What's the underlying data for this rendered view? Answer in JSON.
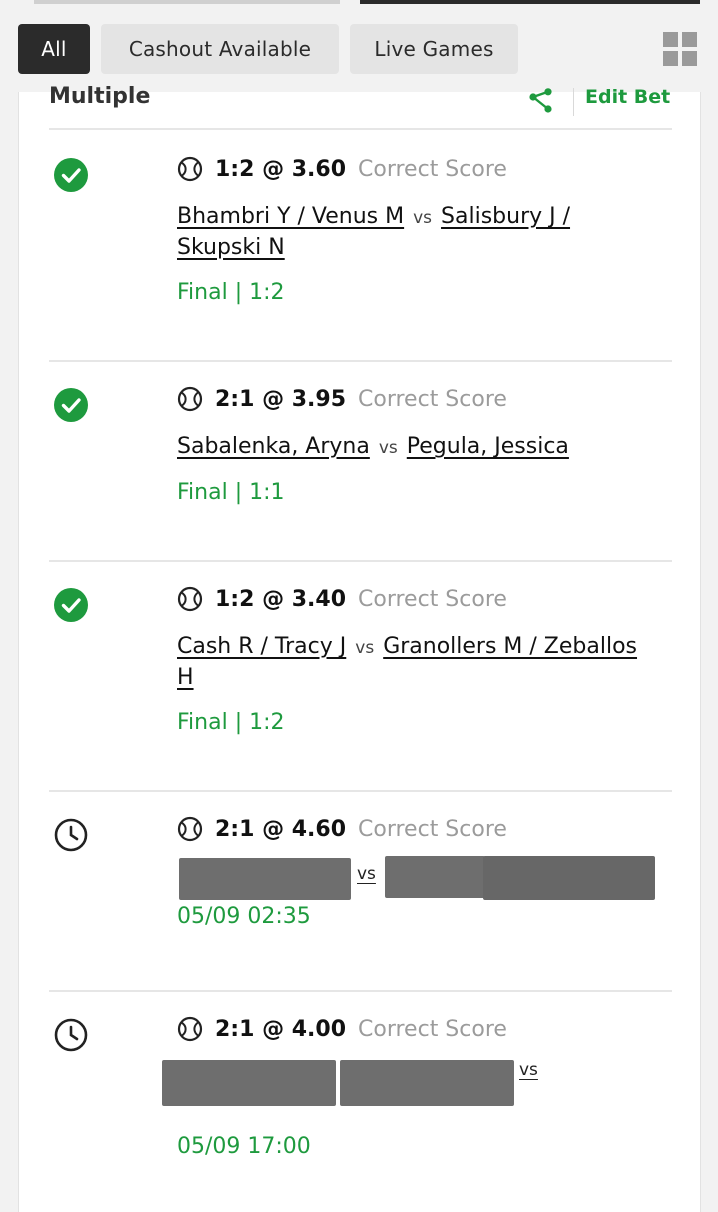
{
  "filters": {
    "all": "All",
    "cashout": "Cashout Available",
    "live": "Live Games",
    "layout_icon": "grid-view-icon"
  },
  "bet": {
    "type": "Multiple",
    "edit_label": "Edit Bet",
    "share_icon": "share-icon"
  },
  "legs": [
    {
      "status": "won",
      "status_icon": "check-circle-icon",
      "selection": "1:2 @ 3.60",
      "market": "Correct Score",
      "home": "Bhambri Y / Venus M",
      "vs": "vs",
      "away": "Salisbury J / Skupski N",
      "result": "Final | 1:2"
    },
    {
      "status": "won",
      "status_icon": "check-circle-icon",
      "selection": "2:1 @ 3.95",
      "market": "Correct Score",
      "home": "Sabalenka, Aryna",
      "vs": "vs",
      "away": "Pegula, Jessica",
      "result": "Final | 1:1"
    },
    {
      "status": "won",
      "status_icon": "check-circle-icon",
      "selection": "1:2 @ 3.40",
      "market": "Correct Score",
      "home": "Cash R / Tracy J",
      "vs": "vs",
      "away": "Granollers M / Zeballos H",
      "result": "Final | 1:2"
    },
    {
      "status": "pending",
      "status_icon": "clock-icon",
      "selection": "2:1 @ 4.60",
      "market": "Correct Score",
      "vs": "vs",
      "result": "05/09 02:35"
    },
    {
      "status": "pending",
      "status_icon": "clock-icon",
      "selection": "2:1 @ 4.00",
      "market": "Correct Score",
      "vs": "vs",
      "result": "05/09 17:00"
    }
  ],
  "colors": {
    "accent_green": "#1e9a3e",
    "chip_active": "#2b2b2b",
    "chip_inactive": "#e4e4e4",
    "muted_text": "#9b9b9b"
  }
}
